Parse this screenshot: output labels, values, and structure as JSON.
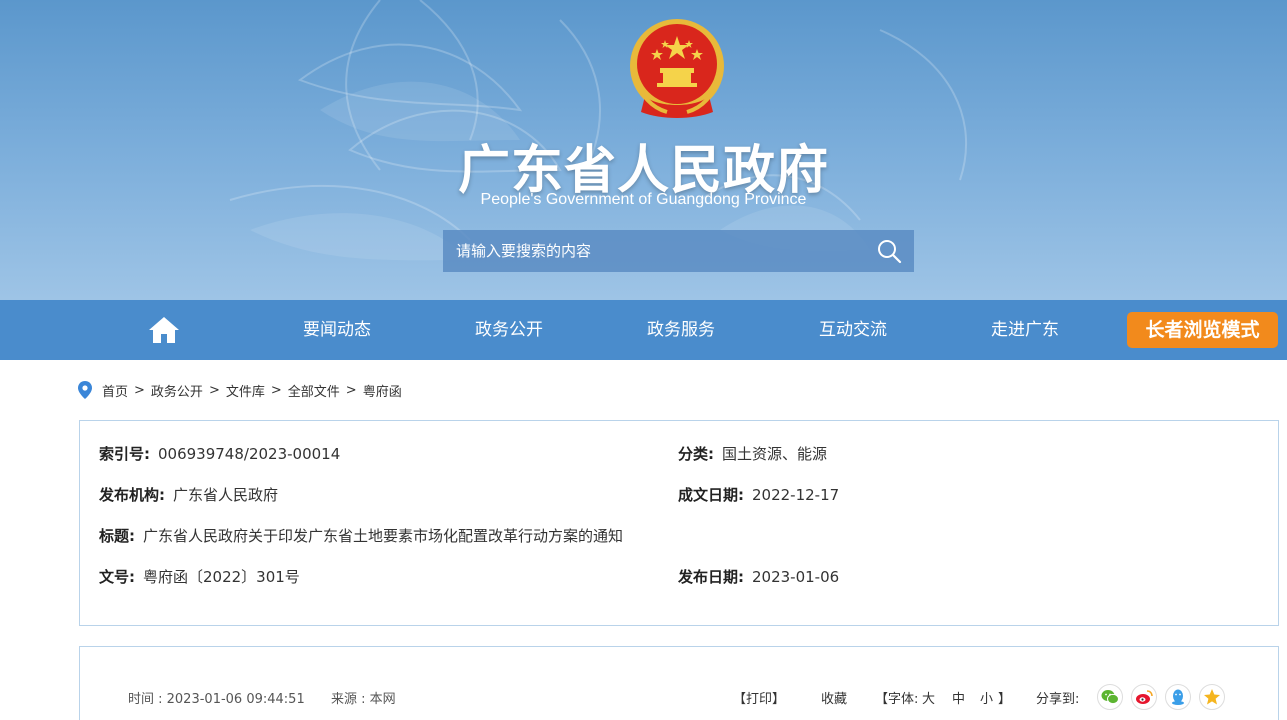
{
  "header": {
    "title": "广东省人民政府",
    "subtitle": "People's Government of Guangdong Province",
    "emblem_icon": "national-emblem-icon"
  },
  "search": {
    "placeholder": "请输入要搜索的内容",
    "icon": "search-icon"
  },
  "nav": {
    "home_icon": "home-icon",
    "items": [
      "要闻动态",
      "政务公开",
      "政务服务",
      "互动交流",
      "走进广东"
    ],
    "elder_mode": "长者浏览模式"
  },
  "breadcrumb": {
    "icon": "location-pin-icon",
    "items": [
      "首页",
      "政务公开",
      "文件库",
      "全部文件",
      "粤府函"
    ],
    "separator": ">"
  },
  "meta": {
    "index_label": "索引号:",
    "index_value": "006939748/2023-00014",
    "category_label": "分类:",
    "category_value": "国土资源、能源",
    "issuer_label": "发布机构:",
    "issuer_value": "广东省人民政府",
    "written_label": "成文日期:",
    "written_value": "2022-12-17",
    "title_label": "标题:",
    "title_value": "广东省人民政府关于印发广东省土地要素市场化配置改革行动方案的通知",
    "docno_label": "文号:",
    "docno_value": "粤府函〔2022〕301号",
    "published_label": "发布日期:",
    "published_value": "2023-01-06"
  },
  "article": {
    "time": "时间 : 2023-01-06 09:44:51",
    "source": "来源 : 本网",
    "print": "【打印】",
    "favorite": "收藏",
    "font_prefix": "【字体:",
    "font_large": "大",
    "font_medium": "中",
    "font_small": "小",
    "font_suffix": "】",
    "share_label": "分享到:",
    "share_icons": [
      "wechat-icon",
      "weibo-icon",
      "qq-icon",
      "qzone-icon"
    ]
  },
  "colors": {
    "nav_bg": "#4a8ccc",
    "elder_bg": "#f28a1c",
    "border": "#b9d3ea"
  }
}
